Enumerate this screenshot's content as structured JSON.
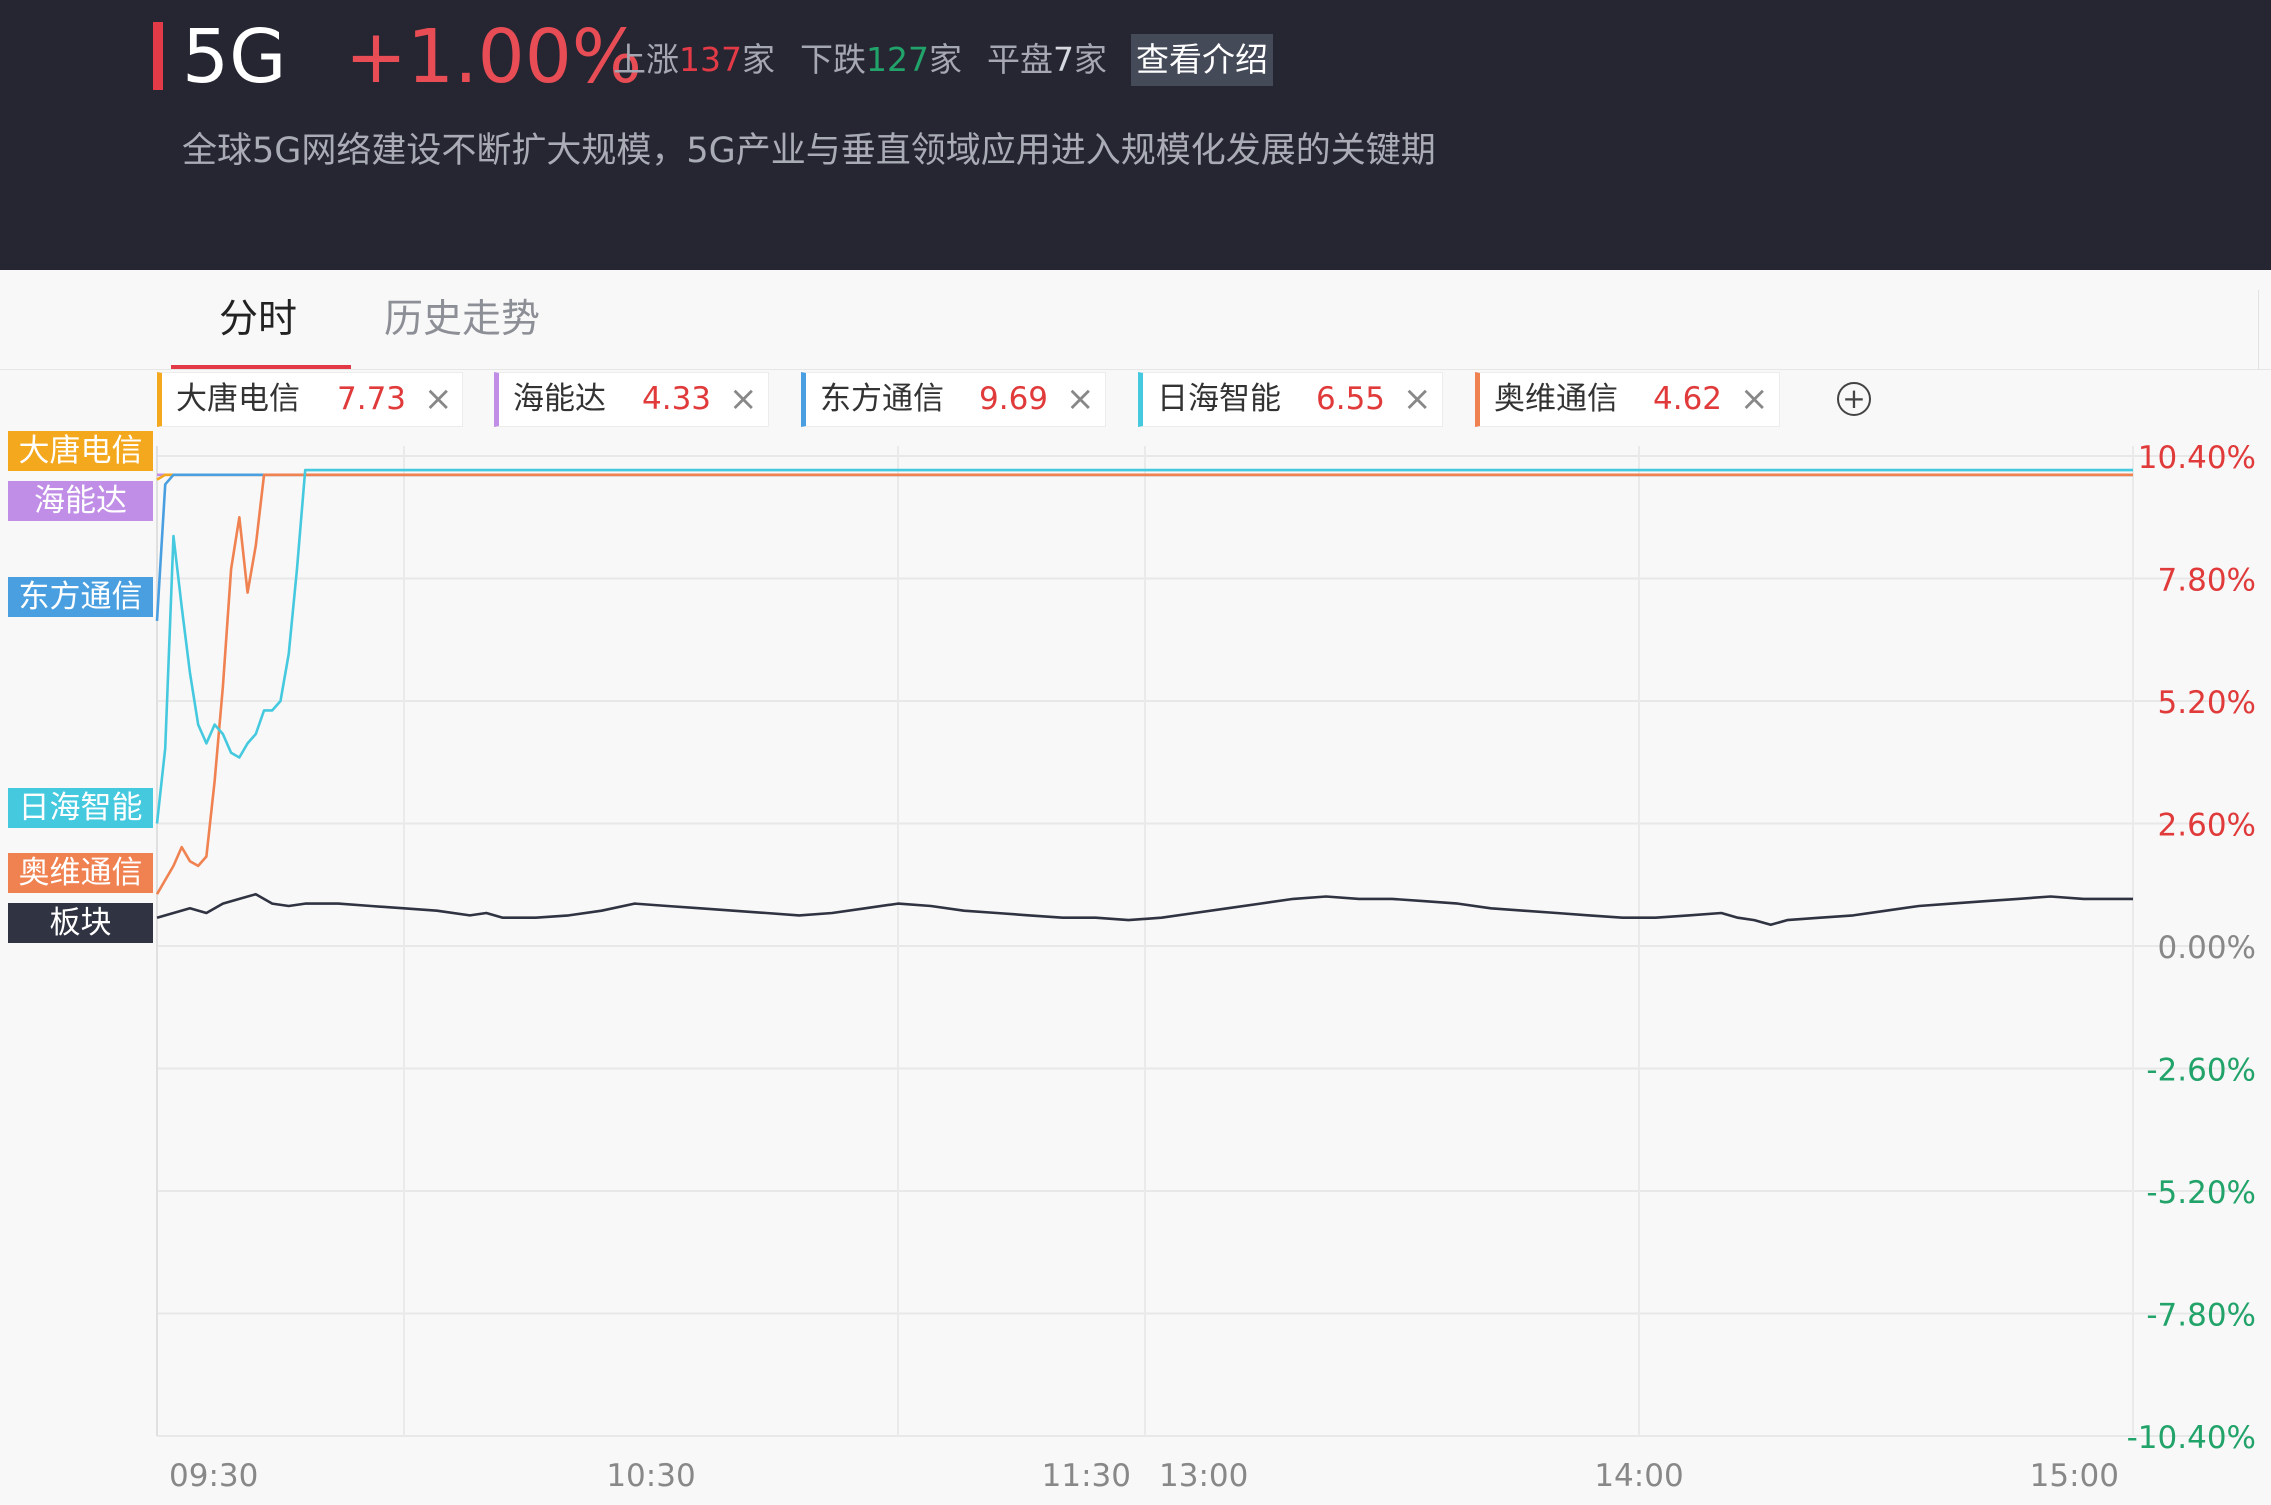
{
  "header": {
    "sector_name": "5G",
    "change": "+1.00%",
    "up_label": "上涨",
    "up_count": "137",
    "down_label": "下跌",
    "down_count": "127",
    "flat_label": "平盘",
    "flat_count": "7",
    "unit": "家",
    "intro_button": "查看介绍",
    "description": "全球5G网络建设不断扩大规模，5G产业与垂直领域应用进入规模化发展的关键期"
  },
  "tabs": [
    {
      "label": "分时",
      "active": true
    },
    {
      "label": "历史走势",
      "active": false
    }
  ],
  "stock_tags": [
    {
      "name": "大唐电信",
      "value": "7.73",
      "color": "#f4a81d"
    },
    {
      "name": "海能达",
      "value": "4.33",
      "color": "#c08ee6"
    },
    {
      "name": "东方通信",
      "value": "9.69",
      "color": "#4a9fe0"
    },
    {
      "name": "日海智能",
      "value": "6.55",
      "color": "#45c9df"
    },
    {
      "name": "奥维通信",
      "value": "4.62",
      "color": "#f08150"
    }
  ],
  "close_icon": "×",
  "add_icon": "+",
  "left_labels": [
    {
      "name": "大唐电信",
      "color": "#f4a81d"
    },
    {
      "name": "海能达",
      "color": "#c08ee6"
    },
    {
      "name": "东方通信",
      "color": "#4a9fe0"
    },
    {
      "name": "日海智能",
      "color": "#45c9df"
    },
    {
      "name": "奥维通信",
      "color": "#f08150"
    },
    {
      "name": "板块",
      "color": "#303341"
    }
  ],
  "chart_data": {
    "type": "line",
    "title": "",
    "xlabel": "",
    "ylabel": "",
    "ylim": [
      -10.4,
      10.4
    ],
    "y_ticks": [
      "10.40%",
      "7.80%",
      "5.20%",
      "2.60%",
      "0.00%",
      "-2.60%",
      "-5.20%",
      "-7.80%",
      "-10.40%"
    ],
    "y_tick_values": [
      10.4,
      7.8,
      5.2,
      2.6,
      0,
      -2.6,
      -5.2,
      -7.8,
      -10.4
    ],
    "x_ticks": [
      "09:30",
      "10:30",
      "11:30",
      "13:00",
      "14:00",
      "15:00"
    ],
    "x_tick_minutes": [
      0,
      60,
      120,
      120,
      180,
      240
    ],
    "x_range_minutes": [
      0,
      240
    ],
    "grid": true,
    "series": [
      {
        "name": "大唐电信",
        "color": "#f4a81d",
        "points": [
          [
            0,
            9.9
          ],
          [
            1,
            10.0
          ],
          [
            2,
            10.0
          ],
          [
            240,
            10.0
          ]
        ]
      },
      {
        "name": "海能达",
        "color": "#c08ee6",
        "points": [
          [
            0,
            10.0
          ],
          [
            240,
            10.0
          ]
        ]
      },
      {
        "name": "东方通信",
        "color": "#4a9fe0",
        "points": [
          [
            0,
            6.9
          ],
          [
            1,
            9.8
          ],
          [
            2,
            10.0
          ],
          [
            240,
            10.0
          ]
        ]
      },
      {
        "name": "日海智能",
        "color": "#45c9df",
        "points": [
          [
            0,
            2.6
          ],
          [
            1,
            4.2
          ],
          [
            2,
            8.7
          ],
          [
            3,
            7.2
          ],
          [
            4,
            5.8
          ],
          [
            5,
            4.7
          ],
          [
            6,
            4.3
          ],
          [
            7,
            4.7
          ],
          [
            8,
            4.5
          ],
          [
            9,
            4.1
          ],
          [
            10,
            4.0
          ],
          [
            11,
            4.3
          ],
          [
            12,
            4.5
          ],
          [
            13,
            5.0
          ],
          [
            14,
            5.0
          ],
          [
            15,
            5.2
          ],
          [
            16,
            6.2
          ],
          [
            17,
            8.0
          ],
          [
            18,
            10.1
          ],
          [
            240,
            10.1
          ]
        ]
      },
      {
        "name": "奥维通信",
        "color": "#f08150",
        "points": [
          [
            0,
            1.1
          ],
          [
            1,
            1.4
          ],
          [
            2,
            1.7
          ],
          [
            3,
            2.1
          ],
          [
            4,
            1.8
          ],
          [
            5,
            1.7
          ],
          [
            6,
            1.9
          ],
          [
            7,
            3.5
          ],
          [
            8,
            5.5
          ],
          [
            9,
            8.0
          ],
          [
            10,
            9.1
          ],
          [
            11,
            7.5
          ],
          [
            12,
            8.5
          ],
          [
            13,
            10.0
          ],
          [
            240,
            10.0
          ]
        ]
      },
      {
        "name": "板块",
        "color": "#303341",
        "points": [
          [
            0,
            0.6
          ],
          [
            2,
            0.7
          ],
          [
            4,
            0.8
          ],
          [
            6,
            0.7
          ],
          [
            8,
            0.9
          ],
          [
            10,
            1.0
          ],
          [
            12,
            1.1
          ],
          [
            14,
            0.9
          ],
          [
            16,
            0.85
          ],
          [
            18,
            0.9
          ],
          [
            22,
            0.9
          ],
          [
            26,
            0.85
          ],
          [
            30,
            0.8
          ],
          [
            34,
            0.75
          ],
          [
            38,
            0.65
          ],
          [
            40,
            0.7
          ],
          [
            42,
            0.6
          ],
          [
            46,
            0.6
          ],
          [
            50,
            0.65
          ],
          [
            54,
            0.75
          ],
          [
            58,
            0.9
          ],
          [
            62,
            0.85
          ],
          [
            66,
            0.8
          ],
          [
            70,
            0.75
          ],
          [
            74,
            0.7
          ],
          [
            78,
            0.65
          ],
          [
            82,
            0.7
          ],
          [
            86,
            0.8
          ],
          [
            90,
            0.9
          ],
          [
            94,
            0.85
          ],
          [
            98,
            0.75
          ],
          [
            102,
            0.7
          ],
          [
            106,
            0.65
          ],
          [
            110,
            0.6
          ],
          [
            114,
            0.6
          ],
          [
            118,
            0.55
          ],
          [
            122,
            0.6
          ],
          [
            126,
            0.7
          ],
          [
            130,
            0.8
          ],
          [
            134,
            0.9
          ],
          [
            138,
            1.0
          ],
          [
            142,
            1.05
          ],
          [
            146,
            1.0
          ],
          [
            150,
            1.0
          ],
          [
            154,
            0.95
          ],
          [
            158,
            0.9
          ],
          [
            162,
            0.8
          ],
          [
            166,
            0.75
          ],
          [
            170,
            0.7
          ],
          [
            174,
            0.65
          ],
          [
            178,
            0.6
          ],
          [
            182,
            0.6
          ],
          [
            186,
            0.65
          ],
          [
            190,
            0.7
          ],
          [
            192,
            0.6
          ],
          [
            194,
            0.55
          ],
          [
            196,
            0.45
          ],
          [
            198,
            0.55
          ],
          [
            202,
            0.6
          ],
          [
            206,
            0.65
          ],
          [
            210,
            0.75
          ],
          [
            214,
            0.85
          ],
          [
            218,
            0.9
          ],
          [
            222,
            0.95
          ],
          [
            226,
            1.0
          ],
          [
            230,
            1.05
          ],
          [
            234,
            1.0
          ],
          [
            236,
            1.0
          ],
          [
            240,
            1.0
          ]
        ]
      }
    ]
  }
}
